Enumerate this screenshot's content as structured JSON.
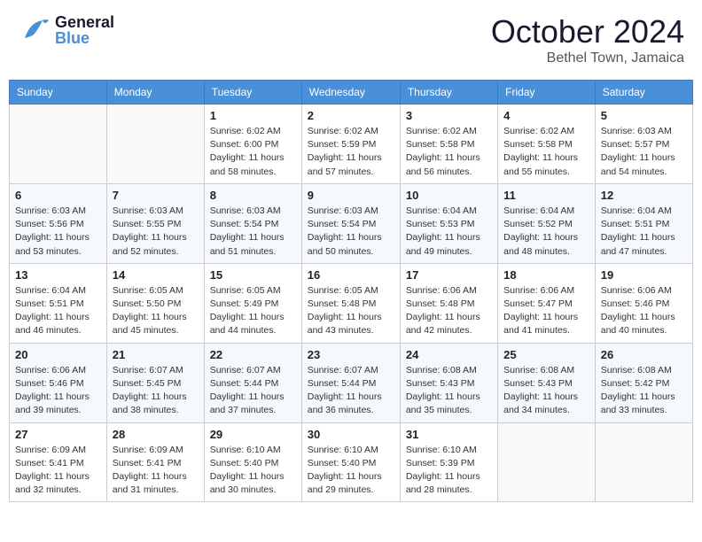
{
  "header": {
    "logo_general": "General",
    "logo_blue": "Blue",
    "month": "October 2024",
    "location": "Bethel Town, Jamaica"
  },
  "days_of_week": [
    "Sunday",
    "Monday",
    "Tuesday",
    "Wednesday",
    "Thursday",
    "Friday",
    "Saturday"
  ],
  "weeks": [
    [
      {
        "day": "",
        "info": ""
      },
      {
        "day": "",
        "info": ""
      },
      {
        "day": "1",
        "info": "Sunrise: 6:02 AM\nSunset: 6:00 PM\nDaylight: 11 hours and 58 minutes."
      },
      {
        "day": "2",
        "info": "Sunrise: 6:02 AM\nSunset: 5:59 PM\nDaylight: 11 hours and 57 minutes."
      },
      {
        "day": "3",
        "info": "Sunrise: 6:02 AM\nSunset: 5:58 PM\nDaylight: 11 hours and 56 minutes."
      },
      {
        "day": "4",
        "info": "Sunrise: 6:02 AM\nSunset: 5:58 PM\nDaylight: 11 hours and 55 minutes."
      },
      {
        "day": "5",
        "info": "Sunrise: 6:03 AM\nSunset: 5:57 PM\nDaylight: 11 hours and 54 minutes."
      }
    ],
    [
      {
        "day": "6",
        "info": "Sunrise: 6:03 AM\nSunset: 5:56 PM\nDaylight: 11 hours and 53 minutes."
      },
      {
        "day": "7",
        "info": "Sunrise: 6:03 AM\nSunset: 5:55 PM\nDaylight: 11 hours and 52 minutes."
      },
      {
        "day": "8",
        "info": "Sunrise: 6:03 AM\nSunset: 5:54 PM\nDaylight: 11 hours and 51 minutes."
      },
      {
        "day": "9",
        "info": "Sunrise: 6:03 AM\nSunset: 5:54 PM\nDaylight: 11 hours and 50 minutes."
      },
      {
        "day": "10",
        "info": "Sunrise: 6:04 AM\nSunset: 5:53 PM\nDaylight: 11 hours and 49 minutes."
      },
      {
        "day": "11",
        "info": "Sunrise: 6:04 AM\nSunset: 5:52 PM\nDaylight: 11 hours and 48 minutes."
      },
      {
        "day": "12",
        "info": "Sunrise: 6:04 AM\nSunset: 5:51 PM\nDaylight: 11 hours and 47 minutes."
      }
    ],
    [
      {
        "day": "13",
        "info": "Sunrise: 6:04 AM\nSunset: 5:51 PM\nDaylight: 11 hours and 46 minutes."
      },
      {
        "day": "14",
        "info": "Sunrise: 6:05 AM\nSunset: 5:50 PM\nDaylight: 11 hours and 45 minutes."
      },
      {
        "day": "15",
        "info": "Sunrise: 6:05 AM\nSunset: 5:49 PM\nDaylight: 11 hours and 44 minutes."
      },
      {
        "day": "16",
        "info": "Sunrise: 6:05 AM\nSunset: 5:48 PM\nDaylight: 11 hours and 43 minutes."
      },
      {
        "day": "17",
        "info": "Sunrise: 6:06 AM\nSunset: 5:48 PM\nDaylight: 11 hours and 42 minutes."
      },
      {
        "day": "18",
        "info": "Sunrise: 6:06 AM\nSunset: 5:47 PM\nDaylight: 11 hours and 41 minutes."
      },
      {
        "day": "19",
        "info": "Sunrise: 6:06 AM\nSunset: 5:46 PM\nDaylight: 11 hours and 40 minutes."
      }
    ],
    [
      {
        "day": "20",
        "info": "Sunrise: 6:06 AM\nSunset: 5:46 PM\nDaylight: 11 hours and 39 minutes."
      },
      {
        "day": "21",
        "info": "Sunrise: 6:07 AM\nSunset: 5:45 PM\nDaylight: 11 hours and 38 minutes."
      },
      {
        "day": "22",
        "info": "Sunrise: 6:07 AM\nSunset: 5:44 PM\nDaylight: 11 hours and 37 minutes."
      },
      {
        "day": "23",
        "info": "Sunrise: 6:07 AM\nSunset: 5:44 PM\nDaylight: 11 hours and 36 minutes."
      },
      {
        "day": "24",
        "info": "Sunrise: 6:08 AM\nSunset: 5:43 PM\nDaylight: 11 hours and 35 minutes."
      },
      {
        "day": "25",
        "info": "Sunrise: 6:08 AM\nSunset: 5:43 PM\nDaylight: 11 hours and 34 minutes."
      },
      {
        "day": "26",
        "info": "Sunrise: 6:08 AM\nSunset: 5:42 PM\nDaylight: 11 hours and 33 minutes."
      }
    ],
    [
      {
        "day": "27",
        "info": "Sunrise: 6:09 AM\nSunset: 5:41 PM\nDaylight: 11 hours and 32 minutes."
      },
      {
        "day": "28",
        "info": "Sunrise: 6:09 AM\nSunset: 5:41 PM\nDaylight: 11 hours and 31 minutes."
      },
      {
        "day": "29",
        "info": "Sunrise: 6:10 AM\nSunset: 5:40 PM\nDaylight: 11 hours and 30 minutes."
      },
      {
        "day": "30",
        "info": "Sunrise: 6:10 AM\nSunset: 5:40 PM\nDaylight: 11 hours and 29 minutes."
      },
      {
        "day": "31",
        "info": "Sunrise: 6:10 AM\nSunset: 5:39 PM\nDaylight: 11 hours and 28 minutes."
      },
      {
        "day": "",
        "info": ""
      },
      {
        "day": "",
        "info": ""
      }
    ]
  ]
}
